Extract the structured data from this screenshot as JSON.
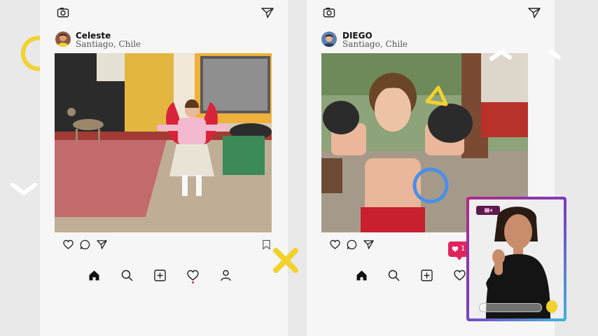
{
  "posts": [
    {
      "username": "Celeste",
      "location": "Santiago, Chile"
    },
    {
      "username": "DIEGO",
      "location": "Santiago, Chile"
    }
  ],
  "icons": {
    "camera": "camera-icon",
    "send": "paper-plane-icon",
    "like": "heart-outline-icon",
    "comment": "comment-bubble-icon",
    "share": "paper-plane-icon",
    "save": "bookmark-icon",
    "home": "home-icon",
    "search": "search-icon",
    "add": "plus-square-icon",
    "activity": "heart-outline-icon",
    "profile": "user-icon"
  },
  "notification": {
    "count": "1"
  },
  "colors": {
    "yellow": "#f2d22e",
    "cyan": "#27c3e5",
    "blue": "#4a8fe7",
    "pink": "#e0245e",
    "panel": "#f6f6f6",
    "background": "#e9e9ea"
  }
}
